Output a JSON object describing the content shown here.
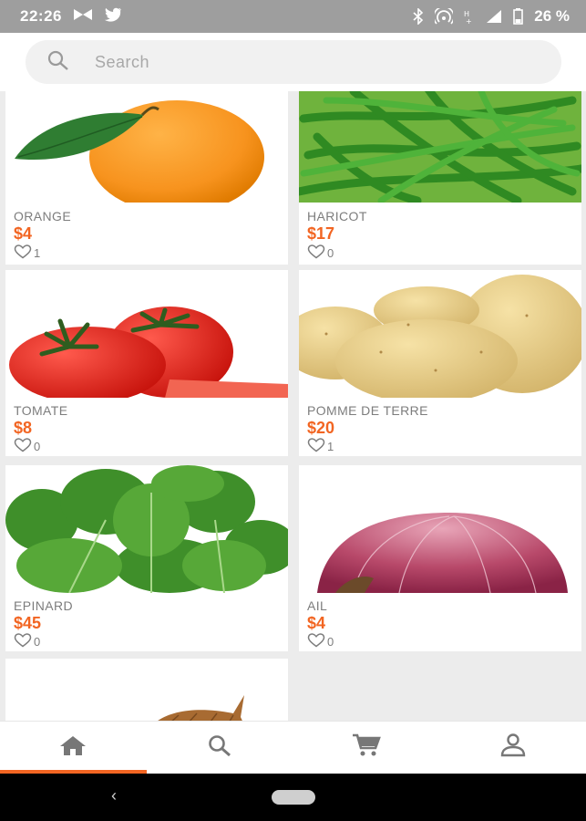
{
  "status_bar": {
    "time": "22:26",
    "battery": "26 %"
  },
  "search": {
    "placeholder": "Search"
  },
  "products": [
    {
      "name": "ORANGE",
      "price": "$4",
      "likes": "1",
      "image": "orange"
    },
    {
      "name": "HARICOT",
      "price": "$17",
      "likes": "0",
      "image": "green-beans"
    },
    {
      "name": "TOMATE",
      "price": "$8",
      "likes": "0",
      "image": "tomato"
    },
    {
      "name": "POMME DE TERRE",
      "price": "$20",
      "likes": "1",
      "image": "potato"
    },
    {
      "name": "EPINARD",
      "price": "$45",
      "likes": "0",
      "image": "spinach"
    },
    {
      "name": "AIL",
      "price": "$4",
      "likes": "0",
      "image": "red-onion"
    },
    {
      "image": "coconut"
    }
  ],
  "bottom_nav": {
    "items": [
      {
        "icon": "home-icon",
        "active": true
      },
      {
        "icon": "search-icon",
        "active": false
      },
      {
        "icon": "cart-icon",
        "active": false
      },
      {
        "icon": "profile-icon",
        "active": false
      }
    ]
  },
  "colors": {
    "accent": "#f26522",
    "status_bar": "#9e9e9e"
  }
}
